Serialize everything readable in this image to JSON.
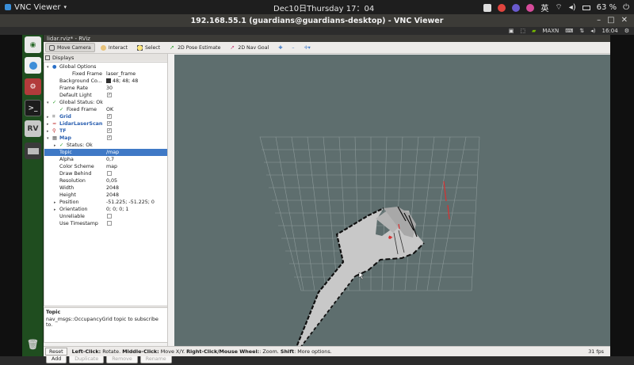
{
  "host": {
    "app_name": "VNC Viewer",
    "clock": "Dec10日Thursday  17：04",
    "input_method": "英",
    "battery": "63 %"
  },
  "vnc": {
    "title": "192.168.55.1 (guardians@guardians-desktop) - VNC Viewer"
  },
  "remote_panel": {
    "power_mode": "MAXN",
    "time": "16:04"
  },
  "rviz": {
    "window_title": "lidar.rviz* - RViz",
    "toolbar": [
      {
        "label": "Move Camera",
        "active": true
      },
      {
        "label": "Interact",
        "active": false
      },
      {
        "label": "Select",
        "active": false
      },
      {
        "label": "2D Pose Estimate",
        "active": false
      },
      {
        "label": "2D Nav Goal",
        "active": false
      }
    ],
    "displays_title": "Displays",
    "tree": {
      "global_options": "Global Options",
      "fixed_frame_label": "Fixed Frame",
      "fixed_frame_value": "laser_frame",
      "background_label": "Background Co...",
      "background_value": "48; 48; 48",
      "frame_rate_label": "Frame Rate",
      "frame_rate_value": "30",
      "default_light_label": "Default Light",
      "global_status": "Global Status: Ok",
      "gs_fixed_frame_label": "Fixed Frame",
      "gs_fixed_frame_value": "OK",
      "grid": "Grid",
      "lidar": "LidarLaserScan",
      "tf": "TF",
      "map": "Map",
      "map_status": "Status: Ok",
      "topic_label": "Topic",
      "topic_value": "/map",
      "alpha_label": "Alpha",
      "alpha_value": "0,7",
      "color_scheme_label": "Color Scheme",
      "color_scheme_value": "map",
      "draw_behind_label": "Draw Behind",
      "resolution_label": "Resolution",
      "resolution_value": "0,05",
      "width_label": "Width",
      "width_value": "2048",
      "height_label": "Height",
      "height_value": "2048",
      "position_label": "Position",
      "position_value": "-51.225; -51.225; 0",
      "orientation_label": "Orientation",
      "orientation_value": "0; 0; 0; 1",
      "unreliable_label": "Unreliable",
      "use_timestamp_label": "Use Timestamp"
    },
    "description": {
      "title": "Topic",
      "text": "nav_msgs::OccupancyGrid topic to subscribe to."
    },
    "buttons": {
      "add": "Add",
      "duplicate": "Duplicate",
      "remove": "Remove",
      "rename": "Rename"
    },
    "status": {
      "reset": "Reset",
      "hint_b1": "Left-Click:",
      "hint_t1": " Rotate. ",
      "hint_b2": "Middle-Click:",
      "hint_t2": " Move X/Y. ",
      "hint_b3": "Right-Click/Mouse Wheel:",
      "hint_t3": ": Zoom. ",
      "hint_b4": "Shift",
      "hint_t4": ": More options.",
      "fps": "31 fps"
    }
  },
  "colors": {
    "view_bg": "#5e6e6e",
    "grid": "#8d9a9a",
    "map_free": "#c8c8c8",
    "map_wall": "#101010",
    "laser": "#d93030",
    "launcher": "#1f4d1f",
    "selection": "#3f79c6"
  }
}
